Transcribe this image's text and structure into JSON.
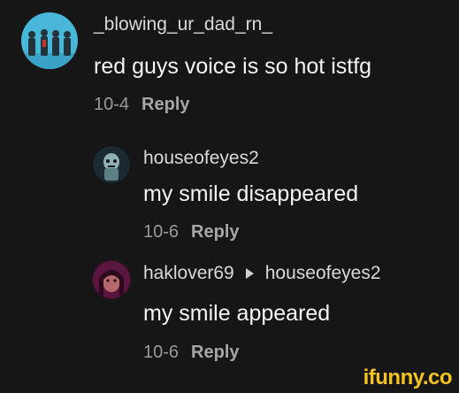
{
  "comments": [
    {
      "username": "_blowing_ur_dad_rn_",
      "text": "red guys voice is so hot istfg",
      "date": "10-4",
      "reply_label": "Reply",
      "avatar_icon": "band-photo-avatar"
    },
    {
      "username": "houseofeyes2",
      "text": "my smile disappeared",
      "date": "10-6",
      "reply_label": "Reply",
      "avatar_icon": "monster-figure-avatar"
    },
    {
      "username": "haklover69",
      "reply_to": "houseofeyes2",
      "text": "my smile appeared",
      "date": "10-6",
      "reply_label": "Reply",
      "avatar_icon": "person-photo-avatar"
    }
  ],
  "watermark": "ifunny.co",
  "colors": {
    "background": "#161616",
    "primary_text": "#f4f4f4",
    "secondary_text": "#9a9a9a",
    "watermark": "#f3c420"
  }
}
